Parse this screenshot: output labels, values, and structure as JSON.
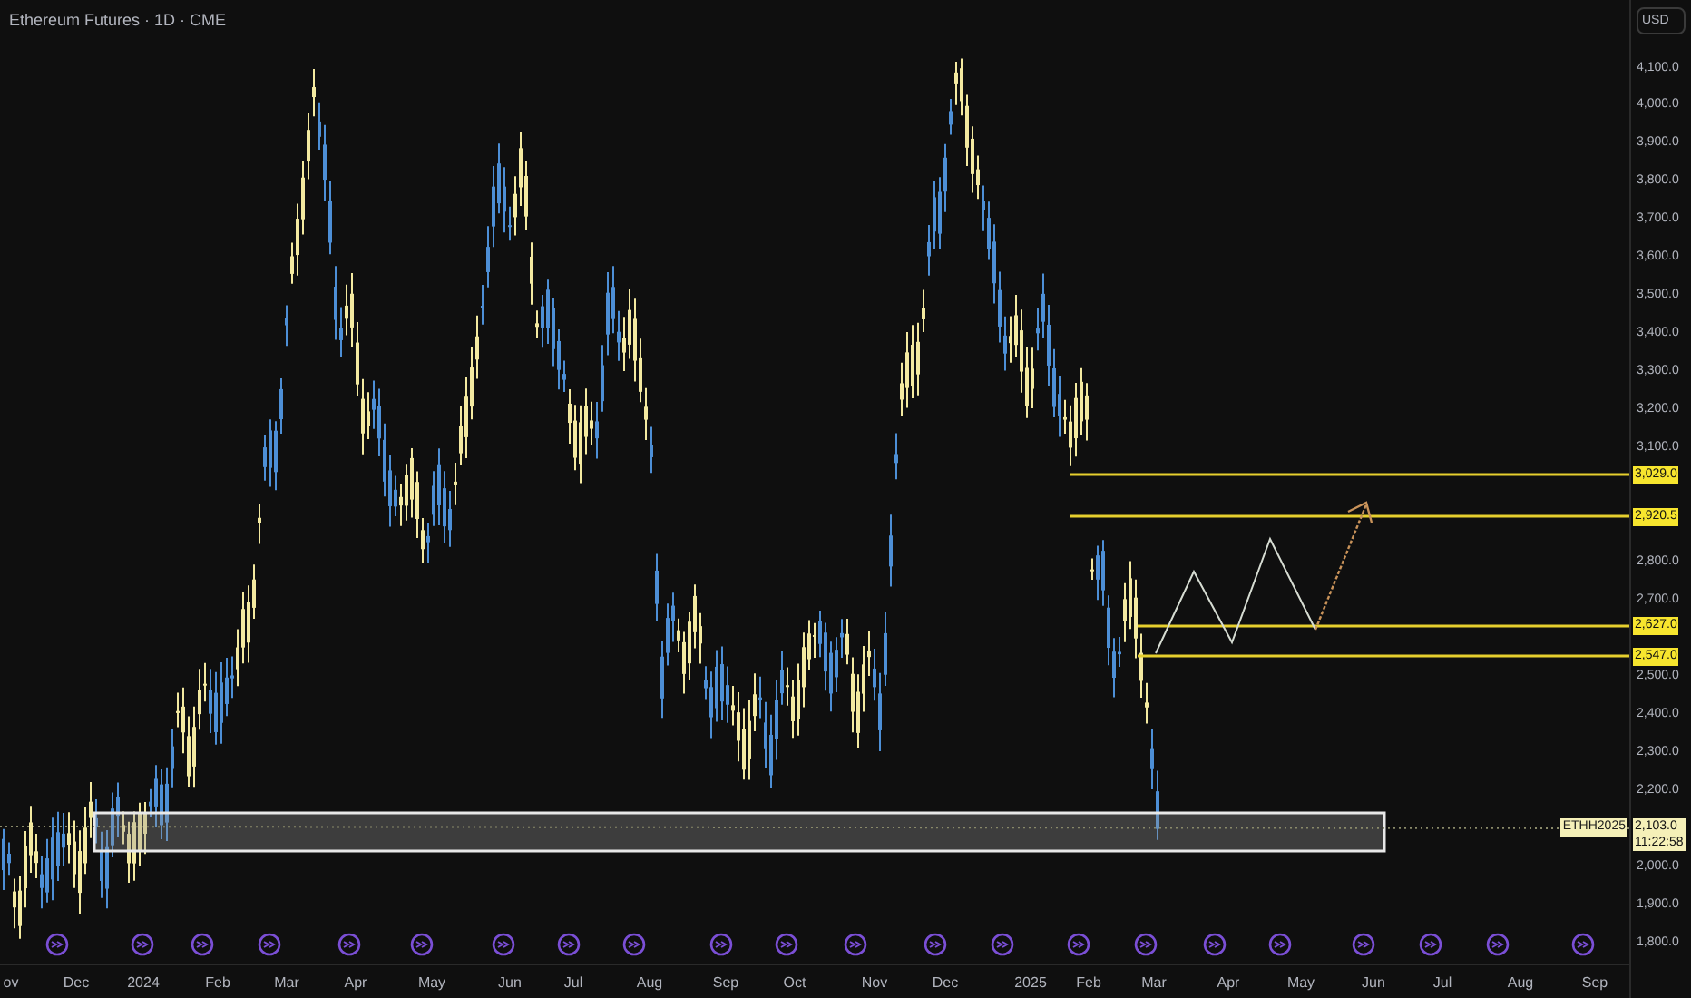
{
  "chart": {
    "title": "Ethereum Futures · 1D · CME"
  },
  "price_axis": {
    "currency": "USD",
    "ticks": [
      "4,100.0",
      "4,000.0",
      "3,900.0",
      "3,800.0",
      "3,700.0",
      "3,600.0",
      "3,500.0",
      "3,400.0",
      "3,300.0",
      "3,200.0",
      "3,100.0",
      "2,800.0",
      "2,700.0",
      "2,500.0",
      "2,400.0",
      "2,300.0",
      "2,200.0",
      "2,000.0",
      "1,900.0",
      "1,800.0"
    ]
  },
  "levels": [
    {
      "label": "3,029.0"
    },
    {
      "label": "2,920.5"
    },
    {
      "label": "2,627.0"
    },
    {
      "label": "2,547.0"
    }
  ],
  "last_price": {
    "symbol": "ETHH2025",
    "price": "2,103.0",
    "countdown": "11:22:58"
  },
  "time_axis": [
    "ov",
    "Dec",
    "2024",
    "Feb",
    "Mar",
    "Apr",
    "May",
    "Jun",
    "Jul",
    "Aug",
    "Sep",
    "Oct",
    "Nov",
    "Dec",
    "2025",
    "Feb",
    "Mar",
    "Apr",
    "May",
    "Jun",
    "Jul",
    "Aug",
    "Sep"
  ]
}
